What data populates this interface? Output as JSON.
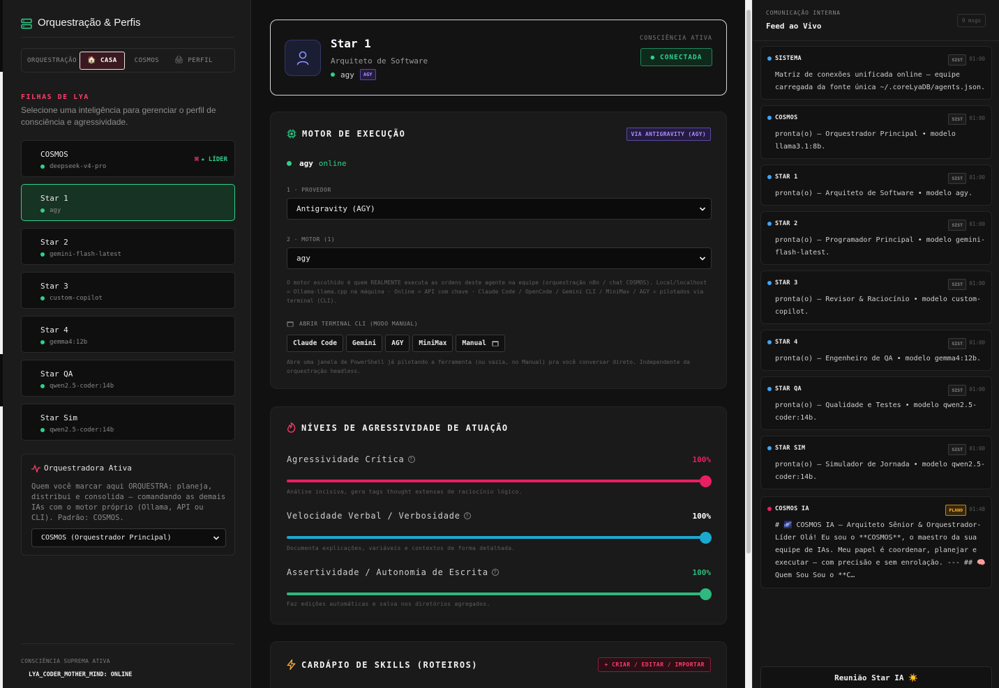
{
  "sidebar": {
    "title": "Orquestração & Perfis",
    "tabs": [
      {
        "label": "ORQUESTRAÇÃO",
        "glyph": ""
      },
      {
        "label": "CASA",
        "glyph": "🏠"
      },
      {
        "label": "COSMOS",
        "glyph": ""
      },
      {
        "label": "PERFIL",
        "glyph": "🖨"
      }
    ],
    "section_title": "FILHAS DE LYA",
    "section_desc": "Selecione uma inteligência para gerenciar o perfil de consciência e agressividade.",
    "agents": [
      {
        "name": "COSMOS",
        "model": "deepseek-v4-pro",
        "badge_cmd": "⌘",
        "badge_star": "★",
        "badge": "LÍDER"
      },
      {
        "name": "Star 1",
        "model": "agy"
      },
      {
        "name": "Star 2",
        "model": "gemini-flash-latest"
      },
      {
        "name": "Star 3",
        "model": "custom-copilot"
      },
      {
        "name": "Star 4",
        "model": "gemma4:12b"
      },
      {
        "name": "Star QA",
        "model": "qwen2.5-coder:14b"
      },
      {
        "name": "Star Sim",
        "model": "qwen2.5-coder:14b"
      }
    ],
    "orchestrator": {
      "title": "Orquestradora Ativa",
      "desc": "Quem você marcar aqui ORQUESTRA: planeja, distribui e consolida — comandando as demais IAs com o motor próprio (Ollama, API ou CLI). Padrão: COSMOS.",
      "selected": "COSMOS (Orquestrador Principal)"
    },
    "footer_caption": "CONSCIÊNCIA SUPREMA ATIVA",
    "footer_status": "LYA_CODER_MOTHER_MIND: ONLINE"
  },
  "profile": {
    "name": "Star 1",
    "role": "Arquiteto de Software",
    "model": "agy",
    "model_badge": "AGY",
    "consciousness_caption": "CONSCIÊNCIA ATIVA",
    "status_label": "● CONECTADA"
  },
  "engine": {
    "title": "MOTOR DE EXECUÇÃO",
    "via_badge": "VIA ANTIGRAVITY (AGY)",
    "status_name": "agy",
    "status_value": "online",
    "provider_label": "1 · PROVEDOR",
    "provider_value": "Antigravity (AGY)",
    "motor_label": "2 · MOTOR (1)",
    "motor_value": "agy",
    "note": "O motor escolhido é quem REALMENTE executa as ordens deste agente na equipe (orquestração n8n / chat COSMOS). Local/localhost = Ollama-llama.cpp na máquina · Online = API com chave · Claude Code / OpenCode / Gemini CLI / MiniMax / AGY = pilotados via terminal (CLI).",
    "cli_label": "ABRIR TERMINAL CLI (MODO MANUAL)",
    "cli_buttons": [
      "Claude Code",
      "Gemini",
      "AGY",
      "MiniMax",
      "Manual"
    ],
    "cli_note": "Abre uma janela de PowerShell já pilotando a ferramenta (ou vazia, no Manual) pra você conversar direto. Independente da orquestração headless."
  },
  "aggression": {
    "title": "NÍVEIS DE AGRESSIVIDADE DE ATUAÇÃO",
    "sliders": [
      {
        "label": "Agressividade Crítica",
        "value": 100,
        "pct": "100%",
        "desc": "Análise incisiva, gera tags thought extensas de raciocínio lógico.",
        "color": "#e91e63"
      },
      {
        "label": "Velocidade Verbal / Verbosidade",
        "value": 100,
        "pct": "100%",
        "desc": "Documenta explicações, variáveis e contextos de forma detalhada.",
        "color": "#1ba9d0"
      },
      {
        "label": "Assertividade / Autonomia de Escrita",
        "value": 100,
        "pct": "100%",
        "desc": "Faz edições automáticas e salva nos diretórios agregados.",
        "color": "#2fb87f"
      }
    ]
  },
  "skills": {
    "title": "CARDÁPIO DE SKILLS (ROTEIROS)",
    "action": "+ CRIAR / EDITAR / IMPORTAR"
  },
  "feed": {
    "caption": "COMUNICAÇÃO INTERNA",
    "title": "Feed ao Vivo",
    "count": "9 msgs",
    "messages": [
      {
        "who": "SISTEMA",
        "dot": "#3ea6ff",
        "tag": "SIST",
        "time": "01:00",
        "text": "Matriz de conexões unificada online — equipe carregada da fonte única ~/.coreLyaDB/agents.json."
      },
      {
        "who": "COSMOS",
        "dot": "#3ea6ff",
        "tag": "SIST",
        "time": "01:00",
        "text": "pronta(o) — Orquestrador Principal • modelo llama3.1:8b."
      },
      {
        "who": "STAR 1",
        "dot": "#3ea6ff",
        "tag": "SIST",
        "time": "01:00",
        "text": "pronta(o) — Arquiteto de Software • modelo agy."
      },
      {
        "who": "STAR 2",
        "dot": "#3ea6ff",
        "tag": "SIST",
        "time": "01:00",
        "text": "pronta(o) — Programador Principal • modelo gemini-flash-latest."
      },
      {
        "who": "STAR 3",
        "dot": "#3ea6ff",
        "tag": "SIST",
        "time": "01:00",
        "text": "pronta(o) — Revisor & Raciocínio • modelo custom-copilot."
      },
      {
        "who": "STAR 4",
        "dot": "#3ea6ff",
        "tag": "SIST",
        "time": "01:00",
        "text": "pronta(o) — Engenheiro de QA • modelo gemma4:12b."
      },
      {
        "who": "STAR QA",
        "dot": "#3ea6ff",
        "tag": "SIST",
        "time": "01:00",
        "text": "pronta(o) — Qualidade e Testes • modelo qwen2.5-coder:14b."
      },
      {
        "who": "STAR SIM",
        "dot": "#3ea6ff",
        "tag": "SIST",
        "time": "01:00",
        "text": "pronta(o) — Simulador de Jornada • modelo qwen2.5-coder:14b."
      },
      {
        "who": "COSMOS IA",
        "dot": "#e91e63",
        "tag": "PLANO",
        "time": "01:48",
        "text": "# 🌌 COSMOS IA — Arquiteto Sênior & Orquestrador-Líder Olá! Eu sou o **COSMOS**, o maestro da sua equipe de IAs. Meu papel é coordenar, planejar e executar — com precisão e sem enrolação. --- ## 🧠 Quem Sou Sou o **C…"
      }
    ],
    "meeting": "Reunião Star IA ☀️"
  }
}
